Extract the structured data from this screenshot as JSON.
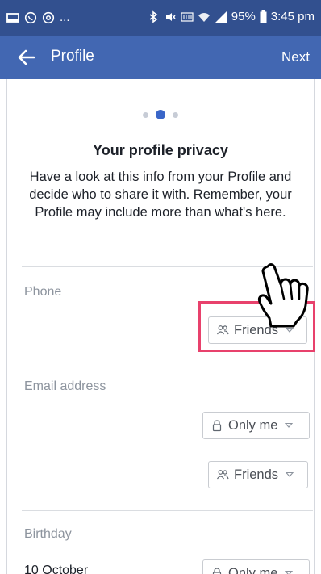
{
  "status_bar": {
    "left_dots": "...",
    "battery": "95%",
    "time": "3:45 pm"
  },
  "app_bar": {
    "title": "Profile",
    "next_label": "Next",
    "back_icon": "arrow-left-icon"
  },
  "pager": {
    "pages": 3,
    "active_index": 1
  },
  "heading": "Your profile privacy",
  "description": "Have a look at this info from your Profile and decide who to share it with. Remember, your Profile may include more than what's here.",
  "sections": {
    "phone": {
      "label": "Phone",
      "audience": "Friends",
      "audience_icon": "friends-icon"
    },
    "email": {
      "label": "Email address",
      "audiences": [
        {
          "value": "Only me",
          "icon": "lock-icon"
        },
        {
          "value": "Friends",
          "icon": "friends-icon"
        }
      ]
    },
    "birthday": {
      "label": "Birthday",
      "value": "10 October",
      "audience": "Only me",
      "audience_icon": "lock-icon"
    }
  },
  "colors": {
    "status_bar": "#32508f",
    "app_bar": "#4267b2",
    "highlight": "#e8416c",
    "active_dot": "#3a66c8"
  }
}
